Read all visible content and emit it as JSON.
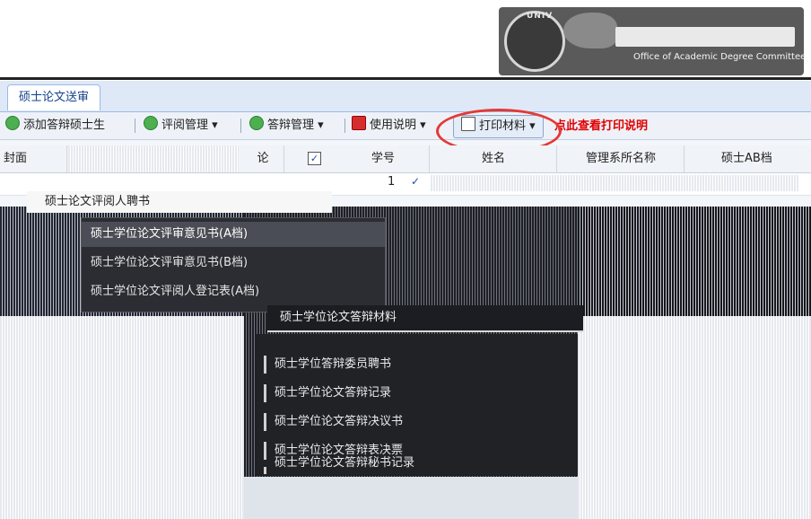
{
  "header": {
    "logo_subtitle": "Office of Academic Degree Committee",
    "logo_badge": "UNIV"
  },
  "tabs": [
    {
      "label": "硕士论文送审"
    }
  ],
  "toolbar": {
    "items": [
      {
        "label": "添加答辩硕士生",
        "icon": "add-icon"
      },
      {
        "label": "评阅管理",
        "icon": "review-icon"
      },
      {
        "label": "答辩管理",
        "icon": "defense-icon"
      },
      {
        "label": "使用说明",
        "icon": "help-icon"
      }
    ],
    "print_label": "打印材料",
    "print_hint": "点此查看打印说明"
  },
  "grid": {
    "headers": [
      "封面",
      "论",
      "学号",
      "姓名",
      "管理系所名称",
      "硕士AB档"
    ],
    "rows": [
      {
        "index": "1",
        "checked": "✓"
      }
    ]
  },
  "menu_level1": {
    "header": "硕士论文评阅人聘书",
    "items": [
      "硕士学位论文评审意见书(A档)",
      "硕士学位论文评审意见书(B档)",
      "硕士学位论文评阅人登记表(A档)"
    ]
  },
  "menu_level2": {
    "header": "硕士学位论文答辩材料",
    "items": [
      "硕士学位答辩委员聘书",
      "硕士学位论文答辩记录",
      "硕士学位论文答辩决议书",
      "硕士学位论文答辩表决票",
      "硕士学位论文答辩秘书记录"
    ]
  }
}
